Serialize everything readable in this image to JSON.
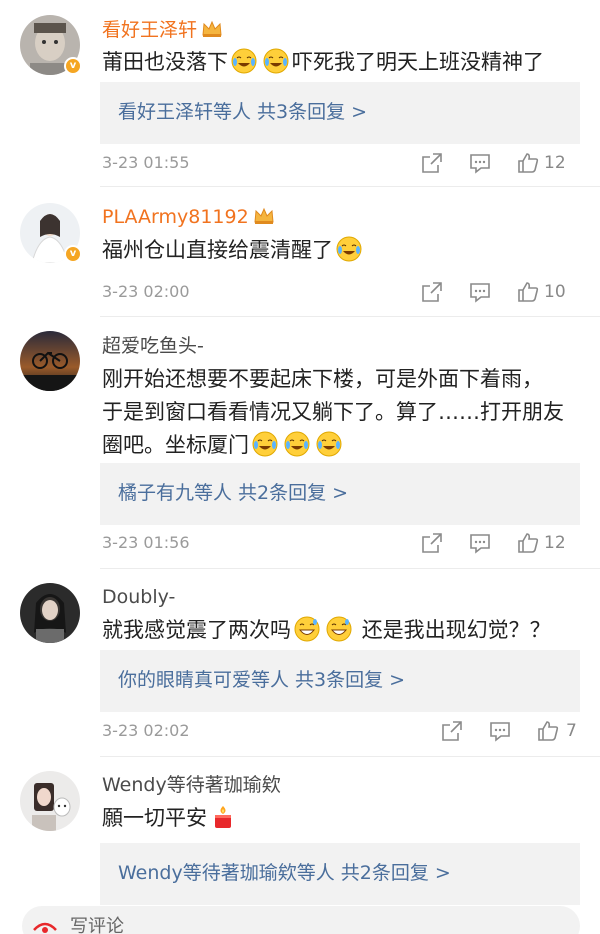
{
  "comments": [
    {
      "username": "看好王泽轩",
      "text_before": "莆田也没落下",
      "text_after": "吓死我了明天上班没精神了",
      "reply_summary": "看好王泽轩等人  共3条回复 >",
      "time": "3-23 01:55",
      "likes": "12"
    },
    {
      "username": "PLAArmy81192",
      "text_before": "福州仓山直接给震清醒了",
      "reply_summary": "",
      "time": "3-23 02:00",
      "likes": "10"
    },
    {
      "username": "超爱吃鱼头-",
      "text_line1": "刚开始还想要不要起床下楼，可是外面下着雨，",
      "text_line2": "于是到窗口看看情况又躺下了。算了……打开朋友",
      "text_line3": "圈吧。坐标厦门",
      "reply_summary": "橘子有九等人  共2条回复 >",
      "time": "3-23 01:56",
      "likes": "12"
    },
    {
      "username": "Doubly-",
      "text_before": "就我感觉震了两次吗",
      "text_after": "还是我出现幻觉？？",
      "reply_summary": "你的眼睛真可爱等人  共3条回复 >",
      "time": "3-23 02:02",
      "likes": "7"
    },
    {
      "username": "Wendy等待著珈瑜欸",
      "text_before": "願一切平安",
      "reply_summary": "Wendy等待著珈瑜欸等人  共2条回复 >",
      "time": "",
      "likes": ""
    }
  ],
  "bottom_bar": {
    "label": "写评论"
  },
  "colors": {
    "vip_name": "#f1731f",
    "link": "#4a6e9c",
    "reply_bg": "#f2f2f2",
    "meta": "#9a9a9a"
  },
  "icons": [
    "verified-badge",
    "vip-crown-icon",
    "laugh-cry-emoji",
    "grin-sweat-emoji",
    "candle-emoji",
    "repost-icon",
    "comment-icon",
    "like-icon"
  ]
}
